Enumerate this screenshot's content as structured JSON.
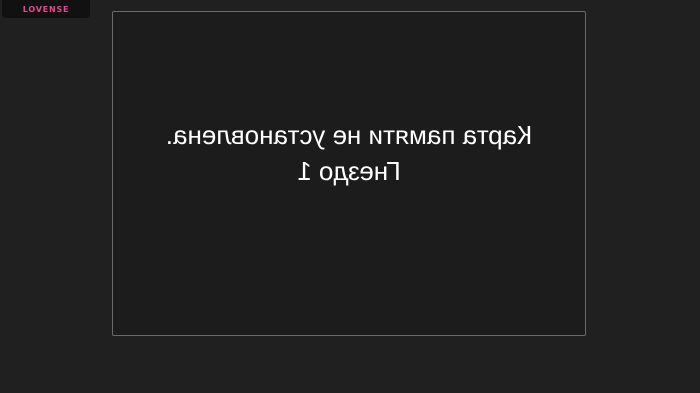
{
  "logo": {
    "text": "LOVENSE"
  },
  "dialog": {
    "line1": "Карта памяти не установлена.",
    "line2": "Гнездо 1"
  },
  "colors": {
    "background": "#202020",
    "dialog_border": "#6a6a6a",
    "logo_accent": "#e6478f",
    "text": "#ffffff"
  }
}
